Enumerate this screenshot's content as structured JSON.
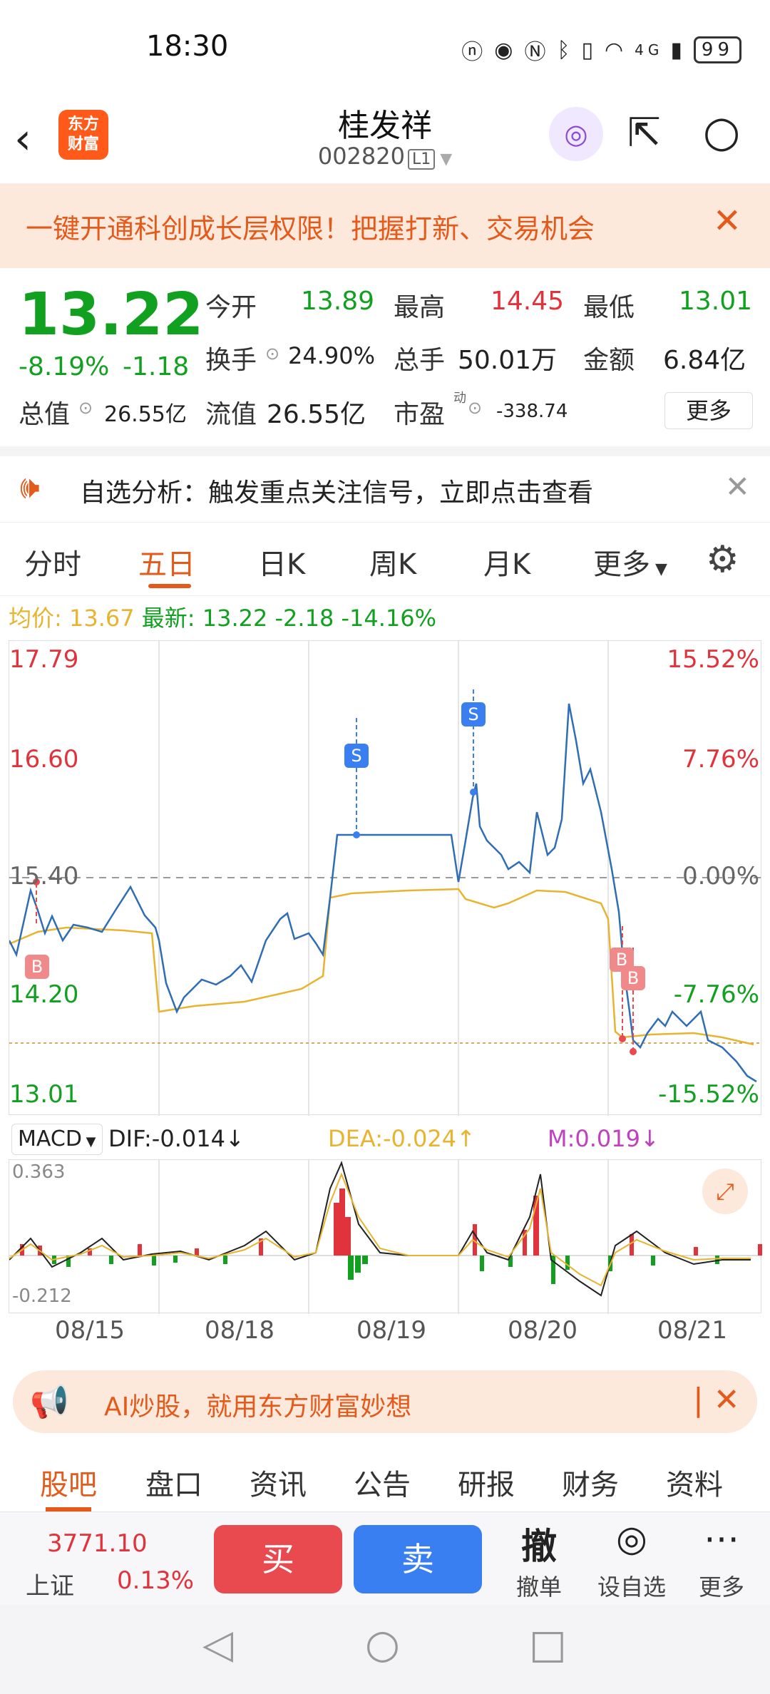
{
  "status_bar": {
    "time": "18:30",
    "icons": [
      "nfc-icon",
      "eye-icon",
      "n-icon",
      "bluetooth-icon",
      "vibrate-icon",
      "wifi-icon",
      "signal-icon"
    ],
    "network": "4G",
    "battery": "99"
  },
  "header": {
    "logo_line1": "东方",
    "logo_line2": "财富",
    "title": "桂发祥",
    "code": "002820",
    "level": "L1"
  },
  "banner_top": {
    "text": "一键开通科创成长层权限！把握打新、交易机会"
  },
  "quote": {
    "price": "13.22",
    "change_pct": "-8.19%",
    "change": "-1.18",
    "open_label": "今开",
    "open": "13.89",
    "high_label": "最高",
    "high": "14.45",
    "low_label": "最低",
    "low": "13.01",
    "turnover_label": "换手",
    "turnover": "24.90%",
    "volume_label": "总手",
    "volume": "50.01万",
    "amount_label": "金额",
    "amount": "6.84亿",
    "mktcap_label": "总值",
    "mktcap": "26.55亿",
    "float_label": "流值",
    "float": "26.55亿",
    "pe_label": "市盈",
    "pe_sup": "动",
    "pe": "-338.74",
    "more": "更多"
  },
  "notice": {
    "text": "自选分析：触发重点关注信号，立即点击查看"
  },
  "tabs": [
    "分时",
    "五日",
    "日K",
    "周K",
    "月K",
    "更多"
  ],
  "active_tab": 1,
  "info_line": {
    "avg_label": "均价:",
    "avg": "13.67",
    "latest_label": "最新:",
    "latest": "13.22",
    "change": "-2.18",
    "change_pct": "-14.16%"
  },
  "chart": {
    "y_left": [
      "17.79",
      "16.60",
      "15.40",
      "14.20",
      "13.01"
    ],
    "y_right": [
      "15.52%",
      "7.76%",
      "0.00%",
      "-7.76%",
      "-15.52%"
    ],
    "markers": [
      "S",
      "S",
      "B",
      "B",
      "B"
    ]
  },
  "macd": {
    "label": "MACD",
    "dif": "DIF:-0.014↓",
    "dea": "DEA:-0.024↑",
    "m": "M:0.019↓",
    "top": "0.363",
    "bottom": "-0.212"
  },
  "dates": [
    "08/15",
    "08/18",
    "08/19",
    "08/20",
    "08/21"
  ],
  "ai_banner": {
    "text": "AI炒股，就用东方财富妙想"
  },
  "bottom_tabs": [
    "股吧",
    "盘口",
    "资讯",
    "公告",
    "研报",
    "财务",
    "资料"
  ],
  "index": {
    "value": "3771.10",
    "name": "上证",
    "pct": "0.13%"
  },
  "actions": {
    "buy": "买",
    "sell": "卖",
    "cancel_icon": "撤",
    "cancel": "撤单",
    "watch": "设自选",
    "more": "更多"
  },
  "colors": {
    "up": "#e0333b",
    "down": "#12a021",
    "accent": "#e35a1b",
    "buy": "#e84a50",
    "sell": "#3a7ff2",
    "avg_line": "#e8b430",
    "price_line": "#2f6db5"
  }
}
